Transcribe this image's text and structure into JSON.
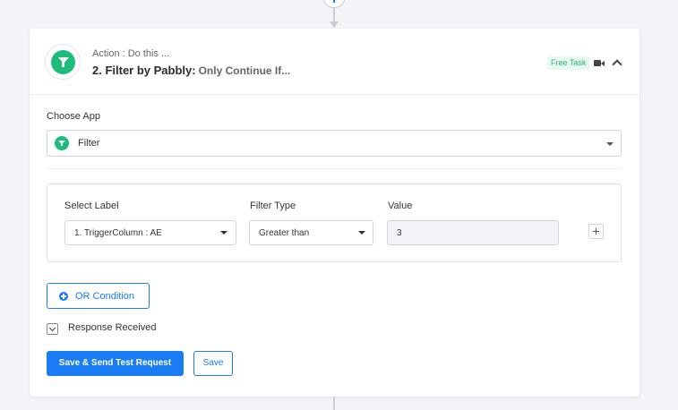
{
  "step": {
    "subtitle": "Action : Do this ...",
    "title": "2. Filter by Pabbly:",
    "description": "Only Continue If...",
    "badge": "Free Task"
  },
  "choose_app": {
    "label": "Choose App",
    "value": "Filter"
  },
  "filter": {
    "select_label_header": "Select Label",
    "filter_type_header": "Filter Type",
    "value_header": "Value",
    "select_label_value": "1. TriggerColumn : AE",
    "filter_type_value": "Greater than",
    "value_value": "3"
  },
  "or_condition_label": "OR Condition",
  "response_received_label": "Response Received",
  "buttons": {
    "save_send": "Save & Send Test Request",
    "save": "Save"
  },
  "colors": {
    "accent": "#1a7cf3",
    "app_green": "#1dbc7b",
    "badge_bg": "#e6f8ef",
    "badge_text": "#2bb673"
  }
}
